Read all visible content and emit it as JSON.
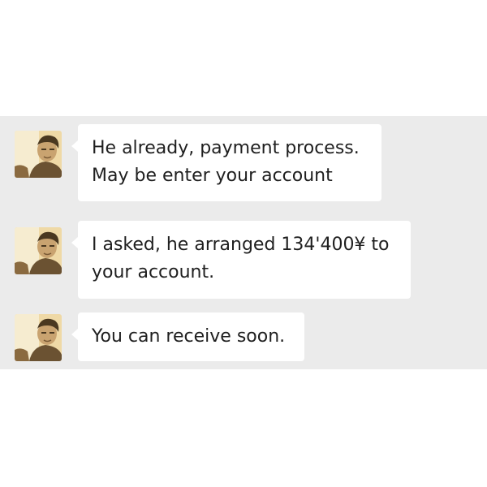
{
  "messages": [
    {
      "sender": "contact",
      "lines": [
        "He already, payment process.",
        "May be enter your account"
      ]
    },
    {
      "sender": "contact",
      "lines": [
        "I asked, he arranged 134'400¥ to",
        "your account."
      ]
    },
    {
      "sender": "contact",
      "lines": [
        "You can receive soon."
      ]
    }
  ],
  "colors": {
    "chat_background": "#ebebeb",
    "bubble_background": "#ffffff",
    "text": "#1f1f1f",
    "avatar_tone": "sepia"
  }
}
